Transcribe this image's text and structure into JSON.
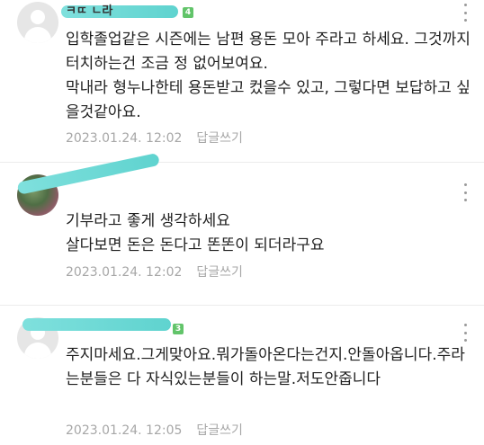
{
  "comments": [
    {
      "level": "4",
      "nickname_visible": "ㅋㄸ          ㄴ라",
      "text": "입학졸업같은 시즌에는 남편 용돈 모아 주라고 하세요. 그것까지 터치하는건 조금 정 없어보여요.\n막내라 형누나한테 용돈받고 컸을수 있고, 그렇다면 보답하고 싶을것같아요.",
      "timestamp": "2023.01.24. 12:02",
      "reply_label": "답글쓰기"
    },
    {
      "level": "",
      "text": "기부라고 좋게 생각하세요\n살다보면 돈은 돈다고 똔똔이 되더라구요",
      "timestamp": "2023.01.24. 12:02",
      "reply_label": "답글쓰기"
    },
    {
      "level": "3",
      "text": "주지마세요.그게맞아요.뭐가돌아온다는건지.안돌아옵니다.주라는분들은 다 자식있는분들이 하는말.저도안줍니다",
      "timestamp": "2023.01.24. 12:05",
      "reply_label": "답글쓰기"
    }
  ],
  "icons": {
    "more": "more-vertical-icon",
    "avatar_default": "person-icon"
  },
  "colors": {
    "level_badge": "#62c46a",
    "nickname_mask": "#5fd3cf",
    "meta_text": "#a7a7a7",
    "divider": "#ececec"
  }
}
